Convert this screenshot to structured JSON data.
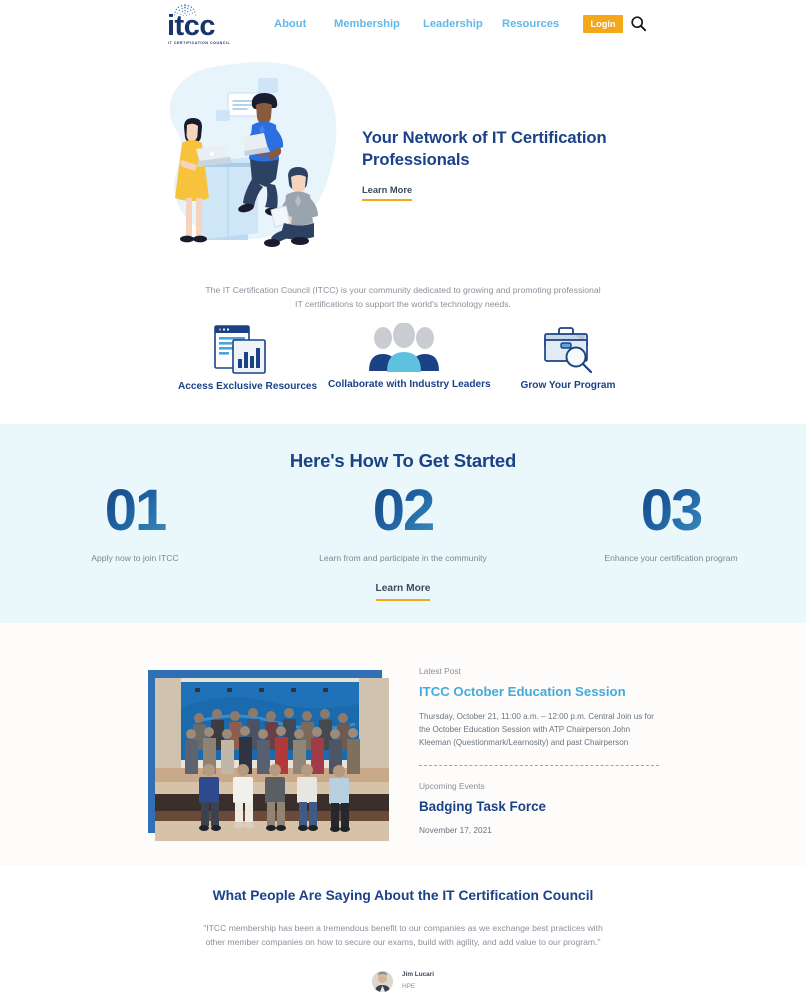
{
  "header": {
    "logo": {
      "wordmark": "itcc",
      "tagline": "IT CERTIFICATION COUNCIL"
    },
    "nav": [
      {
        "label": "About"
      },
      {
        "label": "Membership"
      },
      {
        "label": "Leadership"
      },
      {
        "label": "Resources"
      }
    ],
    "login_label": "Login",
    "search_icon": "search-icon"
  },
  "hero": {
    "title": "Your Network of IT Certification Professionals",
    "cta_label": "Learn More",
    "illustration": "three-people-collaborating-illustration"
  },
  "intro": {
    "paragraph": "The IT Certification Council (ITCC) is your community dedicated to growing and promoting professional IT certifications to support the world's technology needs."
  },
  "features": [
    {
      "label": "Access Exclusive Resources",
      "icon": "document-chart-icon"
    },
    {
      "label": "Collaborate with Industry Leaders",
      "icon": "people-group-icon"
    },
    {
      "label": "Grow Your Program",
      "icon": "briefcase-magnifier-icon"
    }
  ],
  "get_started": {
    "title": "Here's How To Get Started",
    "steps": [
      {
        "number": "01",
        "description": "Apply now to join ITCC"
      },
      {
        "number": "02",
        "description": "Learn from and participate in the community"
      },
      {
        "number": "03",
        "description": "Enhance your certification program"
      }
    ],
    "cta_label": "Learn More",
    "background_color": "#eaf8fc"
  },
  "posts": {
    "photo_caption": "itcc-group-photo",
    "latest": {
      "eyebrow": "Latest Post",
      "title": "ITCC October Education Session",
      "body": "Thursday, October 21, 11:00 a.m. – 12:00 p.m. Central Join us for the October Education Session with ATP Chairperson John Kleeman (Questionmark/Learnosity) and past Chairperson"
    },
    "upcoming": {
      "eyebrow": "Upcoming Events",
      "title": "Badging Task Force",
      "date": "November 17, 2021"
    }
  },
  "testimonial": {
    "heading": "What People Are Saying About the IT Certification Council",
    "quote": "\"ITCC membership has been a tremendous benefit to our companies as we exchange best practices with other member companies on how to secure our exams, build with agility, and add value to our program.\"",
    "author_name": "Jim Lucari",
    "author_org": "HPE"
  },
  "colors": {
    "brand_navy": "#1b4287",
    "brand_sky": "#62b8e8",
    "accent_orange": "#f3a81c",
    "band_light_blue": "#eaf8fc",
    "link_cyan": "#42abdb"
  }
}
